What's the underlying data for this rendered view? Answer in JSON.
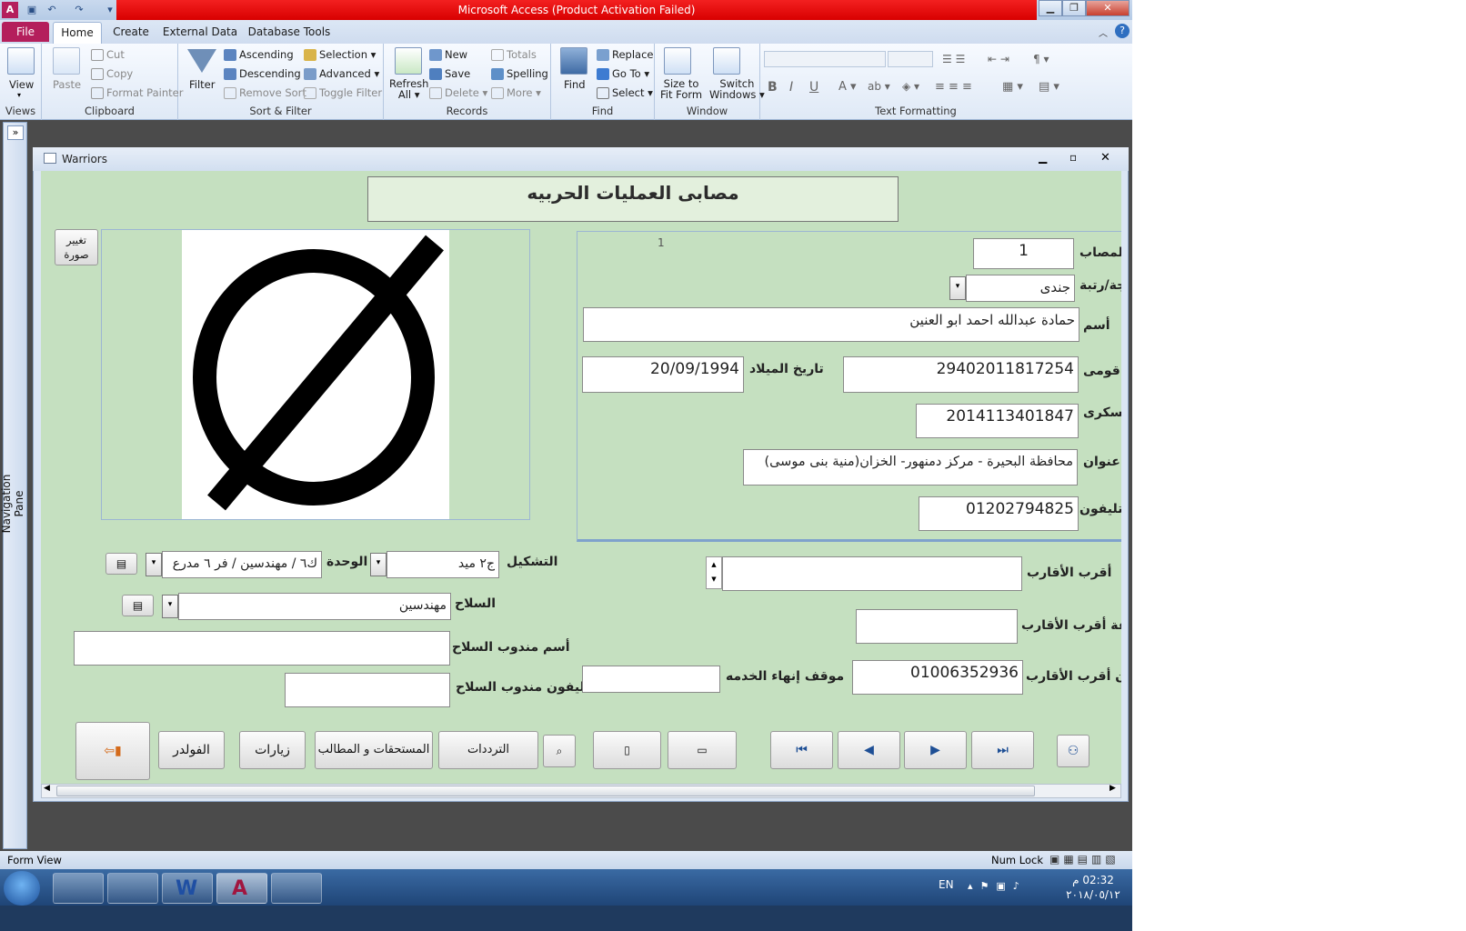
{
  "window": {
    "title": "Microsoft Access (Product Activation Failed)"
  },
  "ribbon_tabs": [
    "File",
    "Home",
    "Create",
    "External Data",
    "Database Tools"
  ],
  "ribbon": {
    "views": {
      "view": "View",
      "group": "Views"
    },
    "clipboard": {
      "paste": "Paste",
      "cut": "Cut",
      "copy": "Copy",
      "format_painter": "Format Painter",
      "group": "Clipboard"
    },
    "sort_filter": {
      "filter": "Filter",
      "ascending": "Ascending",
      "descending": "Descending",
      "remove_sort": "Remove Sort",
      "selection": "Selection",
      "advanced": "Advanced",
      "toggle_filter": "Toggle Filter",
      "group": "Sort & Filter"
    },
    "records": {
      "refresh": "Refresh",
      "refresh2": "All",
      "new": "New",
      "save": "Save",
      "delete": "Delete",
      "totals": "Totals",
      "spelling": "Spelling",
      "more": "More",
      "group": "Records"
    },
    "find": {
      "find": "Find",
      "replace": "Replace",
      "goto": "Go To",
      "select": "Select",
      "group": "Find"
    },
    "window": {
      "size1": "Size to",
      "size2": "Fit Form",
      "switch1": "Switch",
      "switch2": "Windows",
      "group": "Window"
    },
    "text_formatting": {
      "group": "Text Formatting"
    }
  },
  "nav_pane": {
    "label": "Navigation Pane",
    "toggle": "»"
  },
  "form": {
    "title": "Warriors",
    "header": "مصابى العمليات الحربيه",
    "change_photo": "تغيير صورة",
    "record_hint": "1",
    "fields": {
      "injured_no": {
        "label": "المصاب",
        "value": "1"
      },
      "rank": {
        "label": "جة/رتبة",
        "value": "جندى"
      },
      "name": {
        "label": "أسم",
        "value": "حمادة عبدالله احمد ابو العنين"
      },
      "national_id": {
        "label": "م قومى",
        "value": "29402011817254"
      },
      "birth_date": {
        "label": "تاريخ الميلاد",
        "value": "20/09/1994"
      },
      "military_no": {
        "label": "عسكرى",
        "value": "2014113401847"
      },
      "address": {
        "label": "عنوان",
        "value": "محافظة البحيرة - مركز دمنهور- الخزان(منية بنى موسى)"
      },
      "phone": {
        "label": "تليفون",
        "value": "01202794825"
      },
      "formation": {
        "label": "التشكيل",
        "value": "ج٢ ميد"
      },
      "unit": {
        "label": "الوحدة",
        "value": "ك٦ / مهندسين / فر ٦ مدرع"
      },
      "weapon": {
        "label": "السلاح",
        "value": "مهندسين"
      },
      "weapon_rep_name": {
        "label": "أسم مندوب السلاح",
        "value": ""
      },
      "weapon_rep_phone": {
        "label": "تليفون مندوب السلاح",
        "value": ""
      },
      "next_of_kin": {
        "label": "أقرب الأقارب",
        "value": ""
      },
      "kin_relation": {
        "label": "صفة أقرب الأقارب",
        "value": ""
      },
      "kin_phone": {
        "label": "فون أقرب الأقارب",
        "value": "01006352936"
      },
      "service_end": {
        "label": "موقف إنهاء الخدمه",
        "value": ""
      }
    },
    "buttons": {
      "folder": "الفولدر",
      "visits": "زيارات",
      "dues": "المستحقات و المطالب",
      "visits_freq": "الترددات"
    }
  },
  "status": {
    "left": "Form View",
    "num_lock": "Num Lock"
  },
  "taskbar": {
    "lang": "EN",
    "time": "02:32 م",
    "date": "٢٠١٨/٠٥/١٢"
  }
}
